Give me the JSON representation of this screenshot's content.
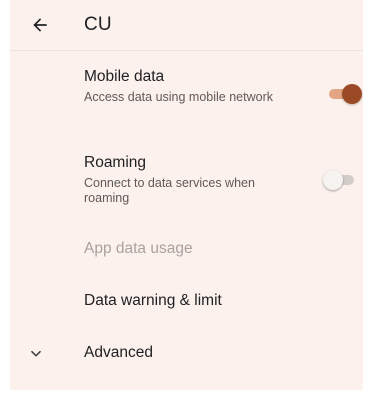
{
  "appbar": {
    "title": "CU"
  },
  "settings": {
    "mobile_data": {
      "title": "Mobile data",
      "subtitle": "Access data using mobile network",
      "enabled": true
    },
    "roaming": {
      "title": "Roaming",
      "subtitle": "Connect to data services when roaming",
      "enabled": false
    },
    "app_data_usage": {
      "title": "App data usage"
    },
    "data_warning": {
      "title": "Data warning & limit"
    },
    "advanced": {
      "title": "Advanced"
    }
  },
  "colors": {
    "background": "#fcf1ec",
    "accent": "#9b4a25",
    "accent_track": "#e3a583"
  }
}
